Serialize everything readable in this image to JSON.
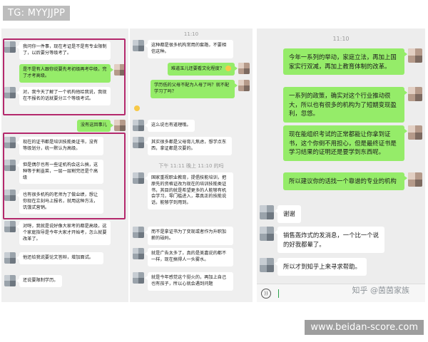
{
  "watermark_tag": "TG: MYYJJPP",
  "site_banner": "www.beidan-score.com",
  "zhihu_watermark": "知乎 @茵茵家族",
  "colors": {
    "sent_bubble": "#95ec69",
    "received_bubble": "#ffffff",
    "chat_background": "#efefef",
    "highlight_frame": "#b4286c"
  },
  "icons": {
    "voice": "voice-input-icon",
    "emoji": "emoji-face-icon"
  },
  "panel1": {
    "messages": [
      {
        "from": "other",
        "text": "我问你一件事，现在考证是不是有专业限制了，以后要分等级考了。"
      },
      {
        "from": "me",
        "text": "是不是有人跟你说要先考初级再考中级，完了才考高级。"
      },
      {
        "from": "other",
        "text": "对，我今天了解了一个机构他给我说，我现在不报名的话就要分三个等级考试。"
      },
      {
        "from": "me",
        "text": "没有这回事儿"
      },
      {
        "from": "other",
        "text": "现在的证书都是培训技能类证书，没有等级划分，统一默认为高级。"
      },
      {
        "from": "other",
        "text": "但是偶尔也有一些证机构会这么搞，这种等于割韭菜，一层一层割完还是个高级"
      },
      {
        "from": "other",
        "text": "也有很多机构的老师为了做业绩，想让你现在立刻马上报名，就用这种方法，饥饿式营销。"
      },
      {
        "from": "other",
        "text": "对呀，我就是说好像大家考的都是高级，这个家庭指导是今年大家才开始考，怎么就要改革了。"
      },
      {
        "from": "other",
        "text": "他还给我说要论文答辩，增加面试。"
      },
      {
        "from": "other",
        "text": "还说要限制学历。"
      }
    ]
  },
  "panel2": {
    "time": "11:10",
    "messages": [
      {
        "from": "other",
        "text": "这种都是很多机构常用的套路，不要相信这种。"
      },
      {
        "from": "me",
        "text": "难道玉儿还要看文化程度？"
      },
      {
        "from": "other",
        "text": "学历低的父母不配为人母了吗？就不配学习了吗？"
      },
      {
        "from": "other",
        "text": "这么说也有道理哦。"
      },
      {
        "from": "other",
        "text": "其实很多都是父母育儿焦虑，想学点东西，拿证都是次要的。"
      },
      {
        "from": "time",
        "text": "下午 11:11 晚上 11:10 的吗"
      },
      {
        "from": "other",
        "text": "国家重视职业教育，提倡技能培训，把原先的资格证改为现在的培训技能类证书，其目的就是希望更多的人能够有机会学习，零门槛进入，靠真正的技能说话，能够学到用到。"
      },
      {
        "from": "other",
        "text": "而不是拿证书为了变现或者作为升职加薪的砝码。"
      },
      {
        "from": "other",
        "text": "就是广告太多了，真的是美嘉说的都不一样，现在搞得人一头雾水。"
      },
      {
        "from": "other",
        "text": "就是今年感觉这个挺火的，再加上自己也有孩子，所以心就会遇到问题"
      }
    ]
  },
  "panel3": {
    "time": "11:10",
    "messages": [
      {
        "from": "me",
        "text": "今年一系列的举动，家庭立法，再加上国家实行双减，再加上教育体制的改革。"
      },
      {
        "from": "me",
        "text": "一系列的政策，确实对这个行业推动很大，所以也有很多的机构为了短期变现盈利，忽悠。"
      },
      {
        "from": "me",
        "text": "现在能组织考试的正常都能让你拿到证书，这个你倒不用担心，但是最终证书是学习结果的证明还是要学到东西呢。"
      },
      {
        "from": "me",
        "text": "所以建议你的话找一个靠谱的专业的机构"
      },
      {
        "from": "other",
        "text": "谢谢"
      },
      {
        "from": "other",
        "text": "销售轰炸式的发消息，一个比一个说的好我都晕了。"
      },
      {
        "from": "other",
        "text": "所以才到知乎上来寻求帮助。"
      }
    ]
  }
}
